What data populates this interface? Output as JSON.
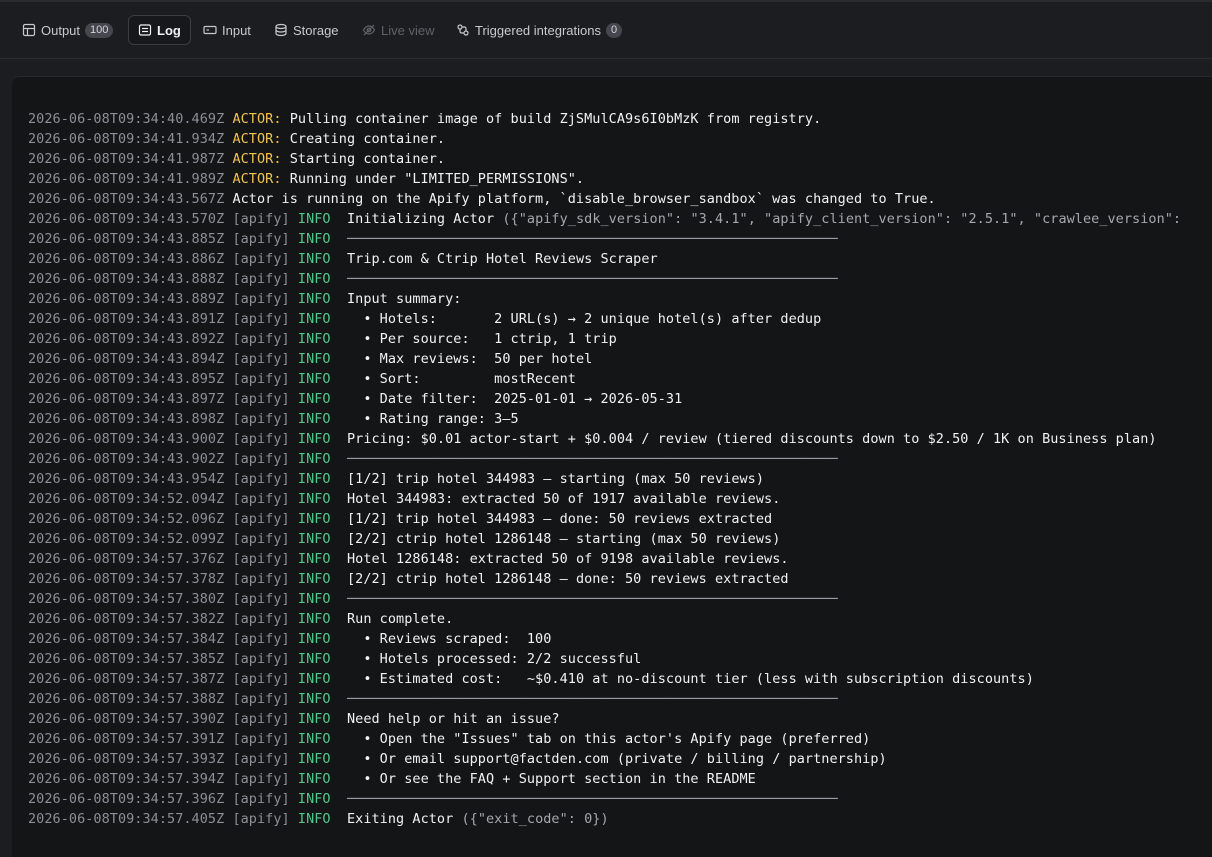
{
  "tabs": [
    {
      "label": "Output",
      "badge": "100",
      "icon": "table-icon",
      "active": false,
      "disabled": false
    },
    {
      "label": "Log",
      "badge": null,
      "icon": "log-icon",
      "active": true,
      "disabled": false
    },
    {
      "label": "Input",
      "badge": null,
      "icon": "input-icon",
      "active": false,
      "disabled": false
    },
    {
      "label": "Storage",
      "badge": null,
      "icon": "database-icon",
      "active": false,
      "disabled": false
    },
    {
      "label": "Live view",
      "badge": null,
      "icon": "eye-off-icon",
      "active": false,
      "disabled": true
    },
    {
      "label": "Triggered integrations",
      "badge": "0",
      "icon": "integrations-icon",
      "active": false,
      "disabled": false
    }
  ],
  "log": {
    "lines": [
      {
        "ts": "2026-06-08T09:34:40.469Z",
        "kind": "actor",
        "prefix": "ACTOR:",
        "msg": "Pulling container image of build ZjSMulCA9s6I0bMzK from registry."
      },
      {
        "ts": "2026-06-08T09:34:41.934Z",
        "kind": "actor",
        "prefix": "ACTOR:",
        "msg": "Creating container."
      },
      {
        "ts": "2026-06-08T09:34:41.987Z",
        "kind": "actor",
        "prefix": "ACTOR:",
        "msg": "Starting container."
      },
      {
        "ts": "2026-06-08T09:34:41.989Z",
        "kind": "actor",
        "prefix": "ACTOR:",
        "msg": "Running under \"LIMITED_PERMISSIONS\"."
      },
      {
        "ts": "2026-06-08T09:34:43.567Z",
        "kind": "plain",
        "msg": "Actor is running on the Apify platform, `disable_browser_sandbox` was changed to True."
      },
      {
        "ts": "2026-06-08T09:34:43.570Z",
        "kind": "info",
        "source": "[apify]",
        "level": "INFO",
        "msg": "Initializing Actor",
        "extra": "({\"apify_sdk_version\": \"3.4.1\", \"apify_client_version\": \"2.5.1\", \"crawlee_version\":"
      },
      {
        "ts": "2026-06-08T09:34:43.885Z",
        "kind": "info",
        "source": "[apify]",
        "level": "INFO",
        "msg": "────────────────────────────────────────────────────────────",
        "divider": true
      },
      {
        "ts": "2026-06-08T09:34:43.886Z",
        "kind": "info",
        "source": "[apify]",
        "level": "INFO",
        "msg": "Trip.com & Ctrip Hotel Reviews Scraper"
      },
      {
        "ts": "2026-06-08T09:34:43.888Z",
        "kind": "info",
        "source": "[apify]",
        "level": "INFO",
        "msg": "────────────────────────────────────────────────────────────",
        "divider": true
      },
      {
        "ts": "2026-06-08T09:34:43.889Z",
        "kind": "info",
        "source": "[apify]",
        "level": "INFO",
        "msg": "Input summary:"
      },
      {
        "ts": "2026-06-08T09:34:43.891Z",
        "kind": "info",
        "source": "[apify]",
        "level": "INFO",
        "msg": "  • Hotels:       2 URL(s) → 2 unique hotel(s) after dedup"
      },
      {
        "ts": "2026-06-08T09:34:43.892Z",
        "kind": "info",
        "source": "[apify]",
        "level": "INFO",
        "msg": "  • Per source:   1 ctrip, 1 trip"
      },
      {
        "ts": "2026-06-08T09:34:43.894Z",
        "kind": "info",
        "source": "[apify]",
        "level": "INFO",
        "msg": "  • Max reviews:  50 per hotel"
      },
      {
        "ts": "2026-06-08T09:34:43.895Z",
        "kind": "info",
        "source": "[apify]",
        "level": "INFO",
        "msg": "  • Sort:         mostRecent"
      },
      {
        "ts": "2026-06-08T09:34:43.897Z",
        "kind": "info",
        "source": "[apify]",
        "level": "INFO",
        "msg": "  • Date filter:  2025-01-01 → 2026-05-31"
      },
      {
        "ts": "2026-06-08T09:34:43.898Z",
        "kind": "info",
        "source": "[apify]",
        "level": "INFO",
        "msg": "  • Rating range: 3–5"
      },
      {
        "ts": "2026-06-08T09:34:43.900Z",
        "kind": "info",
        "source": "[apify]",
        "level": "INFO",
        "msg": "Pricing: $0.01 actor-start + $0.004 / review (tiered discounts down to $2.50 / 1K on Business plan)"
      },
      {
        "ts": "2026-06-08T09:34:43.902Z",
        "kind": "info",
        "source": "[apify]",
        "level": "INFO",
        "msg": "────────────────────────────────────────────────────────────",
        "divider": true
      },
      {
        "ts": "2026-06-08T09:34:43.954Z",
        "kind": "info",
        "source": "[apify]",
        "level": "INFO",
        "msg": "[1/2] trip hotel 344983 — starting (max 50 reviews)"
      },
      {
        "ts": "2026-06-08T09:34:52.094Z",
        "kind": "info",
        "source": "[apify]",
        "level": "INFO",
        "msg": "Hotel 344983: extracted 50 of 1917 available reviews."
      },
      {
        "ts": "2026-06-08T09:34:52.096Z",
        "kind": "info",
        "source": "[apify]",
        "level": "INFO",
        "msg": "[1/2] trip hotel 344983 — done: 50 reviews extracted"
      },
      {
        "ts": "2026-06-08T09:34:52.099Z",
        "kind": "info",
        "source": "[apify]",
        "level": "INFO",
        "msg": "[2/2] ctrip hotel 1286148 — starting (max 50 reviews)"
      },
      {
        "ts": "2026-06-08T09:34:57.376Z",
        "kind": "info",
        "source": "[apify]",
        "level": "INFO",
        "msg": "Hotel 1286148: extracted 50 of 9198 available reviews."
      },
      {
        "ts": "2026-06-08T09:34:57.378Z",
        "kind": "info",
        "source": "[apify]",
        "level": "INFO",
        "msg": "[2/2] ctrip hotel 1286148 — done: 50 reviews extracted"
      },
      {
        "ts": "2026-06-08T09:34:57.380Z",
        "kind": "info",
        "source": "[apify]",
        "level": "INFO",
        "msg": "────────────────────────────────────────────────────────────",
        "divider": true
      },
      {
        "ts": "2026-06-08T09:34:57.382Z",
        "kind": "info",
        "source": "[apify]",
        "level": "INFO",
        "msg": "Run complete."
      },
      {
        "ts": "2026-06-08T09:34:57.384Z",
        "kind": "info",
        "source": "[apify]",
        "level": "INFO",
        "msg": "  • Reviews scraped:  100"
      },
      {
        "ts": "2026-06-08T09:34:57.385Z",
        "kind": "info",
        "source": "[apify]",
        "level": "INFO",
        "msg": "  • Hotels processed: 2/2 successful"
      },
      {
        "ts": "2026-06-08T09:34:57.387Z",
        "kind": "info",
        "source": "[apify]",
        "level": "INFO",
        "msg": "  • Estimated cost:   ~$0.410 at no-discount tier (less with subscription discounts)"
      },
      {
        "ts": "2026-06-08T09:34:57.388Z",
        "kind": "info",
        "source": "[apify]",
        "level": "INFO",
        "msg": "────────────────────────────────────────────────────────────",
        "divider": true
      },
      {
        "ts": "2026-06-08T09:34:57.390Z",
        "kind": "info",
        "source": "[apify]",
        "level": "INFO",
        "msg": "Need help or hit an issue?"
      },
      {
        "ts": "2026-06-08T09:34:57.391Z",
        "kind": "info",
        "source": "[apify]",
        "level": "INFO",
        "msg": "  • Open the \"Issues\" tab on this actor's Apify page (preferred)"
      },
      {
        "ts": "2026-06-08T09:34:57.393Z",
        "kind": "info",
        "source": "[apify]",
        "level": "INFO",
        "msg": "  • Or email support@factden.com (private / billing / partnership)"
      },
      {
        "ts": "2026-06-08T09:34:57.394Z",
        "kind": "info",
        "source": "[apify]",
        "level": "INFO",
        "msg": "  • Or see the FAQ + Support section in the README"
      },
      {
        "ts": "2026-06-08T09:34:57.396Z",
        "kind": "info",
        "source": "[apify]",
        "level": "INFO",
        "msg": "────────────────────────────────────────────────────────────",
        "divider": true
      },
      {
        "ts": "2026-06-08T09:34:57.405Z",
        "kind": "info",
        "source": "[apify]",
        "level": "INFO",
        "msg": "Exiting Actor",
        "extra": "({\"exit_code\": 0})"
      }
    ]
  },
  "colors": {
    "background": "#1c1d21",
    "log_background": "#141517",
    "actor_prefix": "#f4c24f",
    "info_level": "#4fc98a",
    "timestamp": "#8d8f96"
  }
}
